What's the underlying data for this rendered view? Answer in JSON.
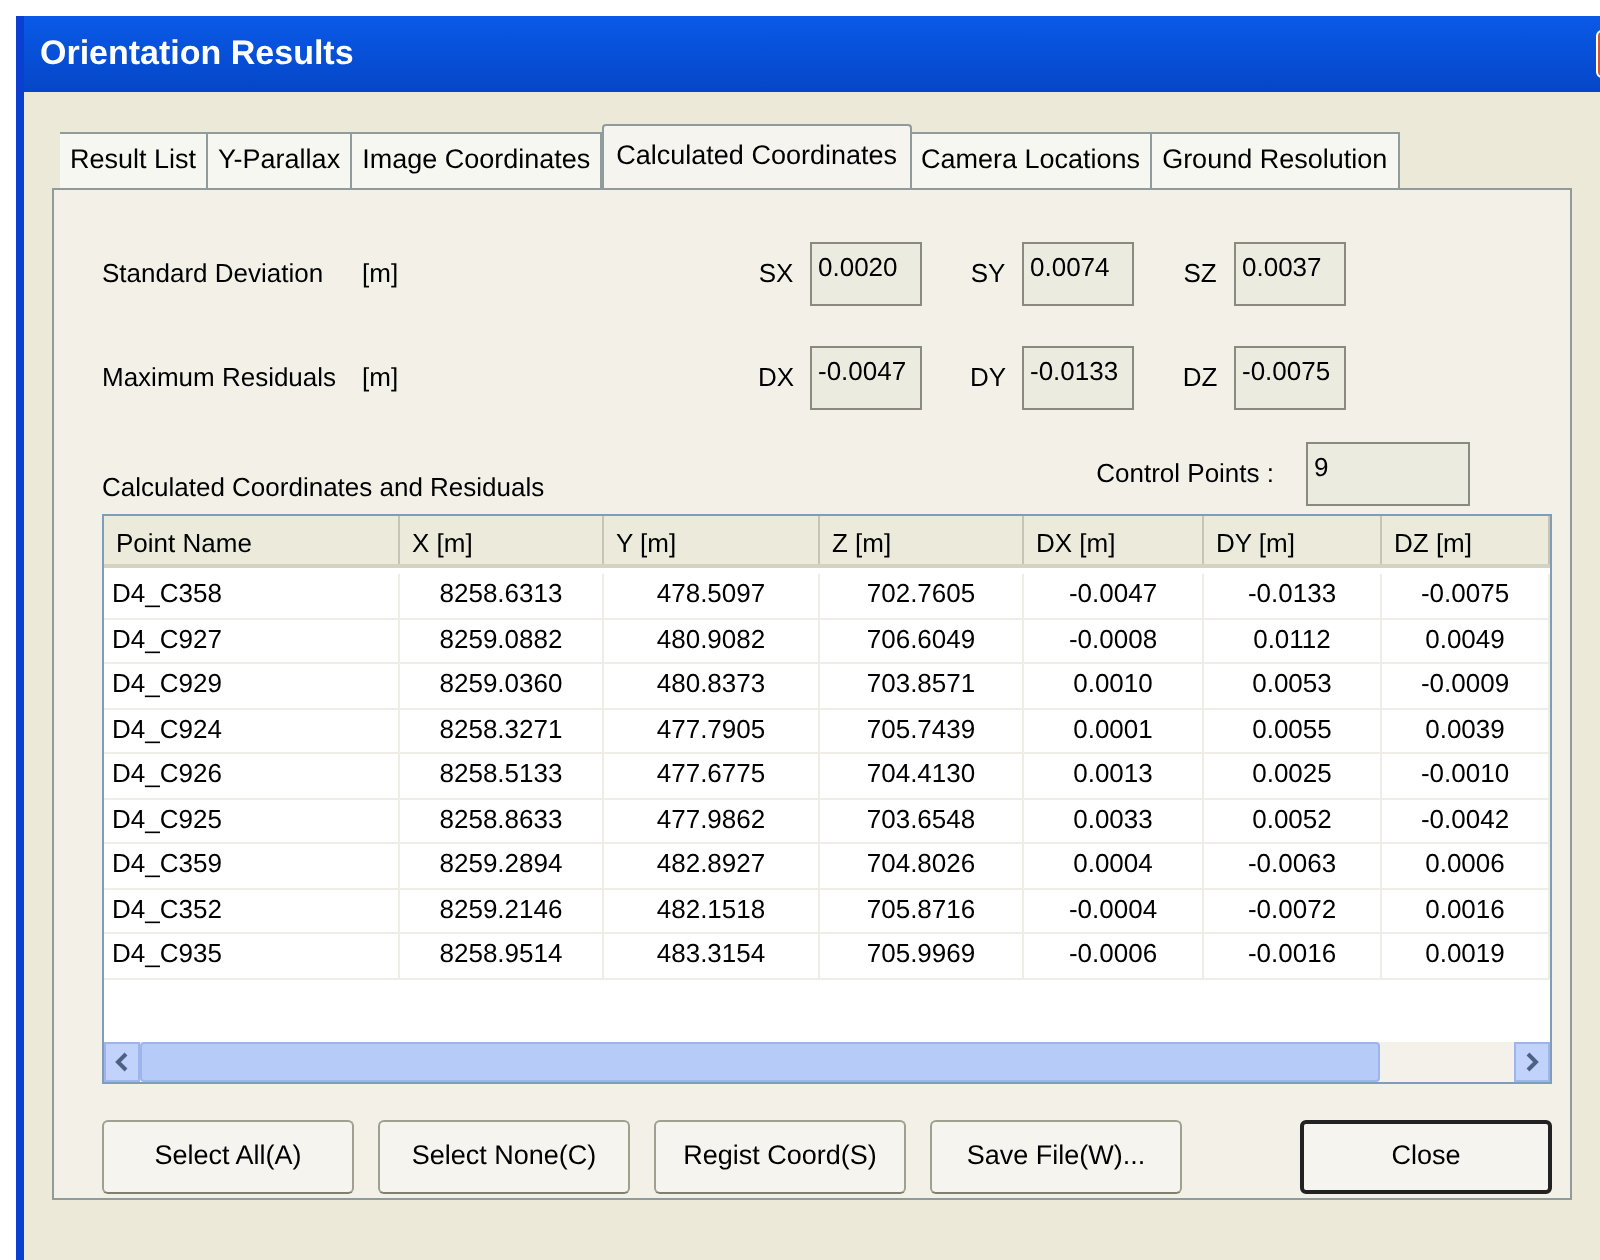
{
  "window": {
    "title": "Orientation Results"
  },
  "tabs": [
    {
      "label": "Result List",
      "selected": false
    },
    {
      "label": "Y-Parallax",
      "selected": false
    },
    {
      "label": "Image Coordinates",
      "selected": false
    },
    {
      "label": "Calculated Coordinates",
      "selected": true
    },
    {
      "label": "Camera Locations",
      "selected": false
    },
    {
      "label": "Ground Resolution",
      "selected": false
    }
  ],
  "stats": [
    {
      "label": "Standard Deviation",
      "unit": "[m]",
      "fields": [
        {
          "axis": "SX",
          "value": "0.0020"
        },
        {
          "axis": "SY",
          "value": "0.0074"
        },
        {
          "axis": "SZ",
          "value": "0.0037"
        }
      ]
    },
    {
      "label": "Maximum Residuals",
      "unit": "[m]",
      "fields": [
        {
          "axis": "DX",
          "value": "-0.0047"
        },
        {
          "axis": "DY",
          "value": "-0.0133"
        },
        {
          "axis": "DZ",
          "value": "-0.0075"
        }
      ]
    }
  ],
  "table_title": "Calculated Coordinates and Residuals",
  "control_points": {
    "label": "Control Points :",
    "value": "9"
  },
  "table": {
    "columns": [
      "Point Name",
      "X [m]",
      "Y [m]",
      "Z [m]",
      "DX [m]",
      "DY [m]",
      "DZ [m]"
    ],
    "rows": [
      [
        "D4_C358",
        "8258.6313",
        "478.5097",
        "702.7605",
        "-0.0047",
        "-0.0133",
        "-0.0075"
      ],
      [
        "D4_C927",
        "8259.0882",
        "480.9082",
        "706.6049",
        "-0.0008",
        "0.0112",
        "0.0049"
      ],
      [
        "D4_C929",
        "8259.0360",
        "480.8373",
        "703.8571",
        "0.0010",
        "0.0053",
        "-0.0009"
      ],
      [
        "D4_C924",
        "8258.3271",
        "477.7905",
        "705.7439",
        "0.0001",
        "0.0055",
        "0.0039"
      ],
      [
        "D4_C926",
        "8258.5133",
        "477.6775",
        "704.4130",
        "0.0013",
        "0.0025",
        "-0.0010"
      ],
      [
        "D4_C925",
        "8258.8633",
        "477.9862",
        "703.6548",
        "0.0033",
        "0.0052",
        "-0.0042"
      ],
      [
        "D4_C359",
        "8259.2894",
        "482.8927",
        "704.8026",
        "0.0004",
        "-0.0063",
        "0.0006"
      ],
      [
        "D4_C352",
        "8259.2146",
        "482.1518",
        "705.8716",
        "-0.0004",
        "-0.0072",
        "0.0016"
      ],
      [
        "D4_C935",
        "8258.9514",
        "483.3154",
        "705.9969",
        "-0.0006",
        "-0.0016",
        "0.0019"
      ]
    ]
  },
  "buttons": [
    {
      "label": "Select All(A)",
      "default": false
    },
    {
      "label": "Select None(C)",
      "default": false
    },
    {
      "label": "Regist Coord(S)",
      "default": false
    },
    {
      "label": "Save File(W)...",
      "default": false
    },
    {
      "label": "Close",
      "default": true
    }
  ]
}
